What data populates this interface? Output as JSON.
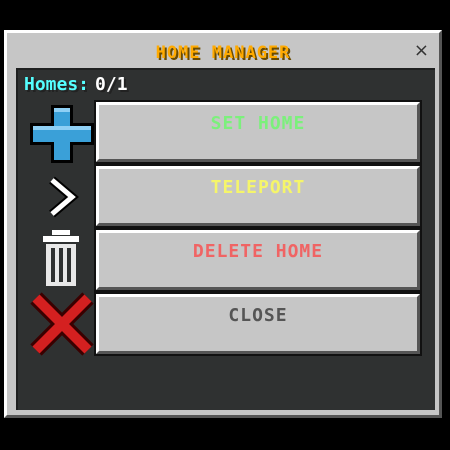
{
  "window": {
    "title": "HOME MANAGER",
    "close_glyph": "×"
  },
  "homes": {
    "label": "Homes:",
    "value": "0/1"
  },
  "buttons": [
    {
      "label": "SET HOME",
      "color": "#7cf07c",
      "icon": "plus-icon"
    },
    {
      "label": "TELEPORT",
      "color": "#f5f56a",
      "icon": "chevron-right-icon"
    },
    {
      "label": "DELETE HOME",
      "color": "#f06464",
      "icon": "trash-icon"
    },
    {
      "label": "CLOSE",
      "color": "#555555",
      "icon": "red-x-icon"
    }
  ],
  "colors": {
    "title": "#ffaa00",
    "homes_label": "#55ffff",
    "background": "#000000",
    "panel": "#2f3131",
    "window": "#c6c6c6"
  }
}
